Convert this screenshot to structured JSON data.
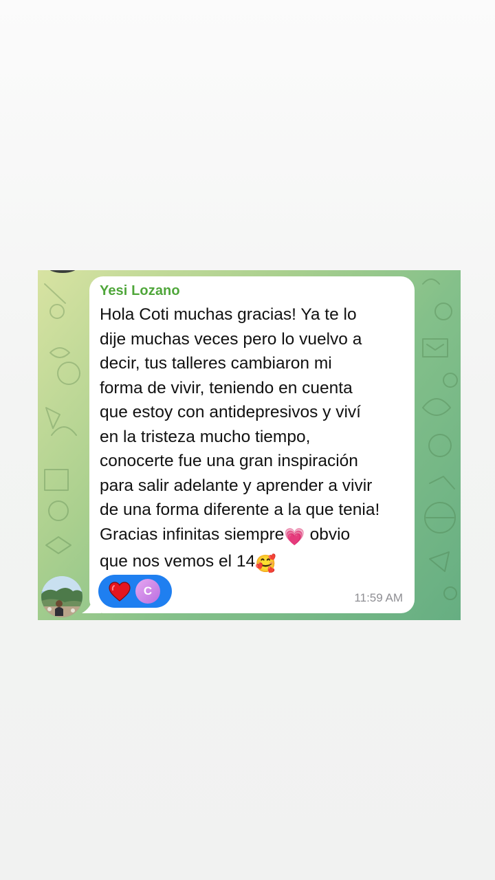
{
  "message": {
    "sender_name": "Yesi Lozano",
    "text_lines": [
      "Hola Coti muchas gracias! Ya te lo",
      "dije muchas veces pero lo vuelvo a",
      "decir, tus talleres cambiaron mi",
      "forma de vivir, teniendo en cuenta",
      "que estoy con antidepresivos y viví",
      "en la tristeza mucho tiempo,",
      "conocerte fue una gran inspiración",
      "para salir adelante y aprender a vivir",
      "de una forma diferente a la que tenia!",
      "Gracias infinitas siempre",
      "obvio",
      "que nos vemos el 14"
    ],
    "emoji_1": "💗",
    "emoji_2": "🥰",
    "time": "11:59 AM"
  },
  "reactions": {
    "emoji_icon": "red-heart-icon",
    "reactor_initial": "C",
    "pill_color": "#1f7ff0"
  },
  "colors": {
    "sender_name": "#4fa63a",
    "bubble": "#ffffff",
    "wallpaper_start": "#d8e3a2",
    "wallpaper_end": "#66ae82"
  }
}
